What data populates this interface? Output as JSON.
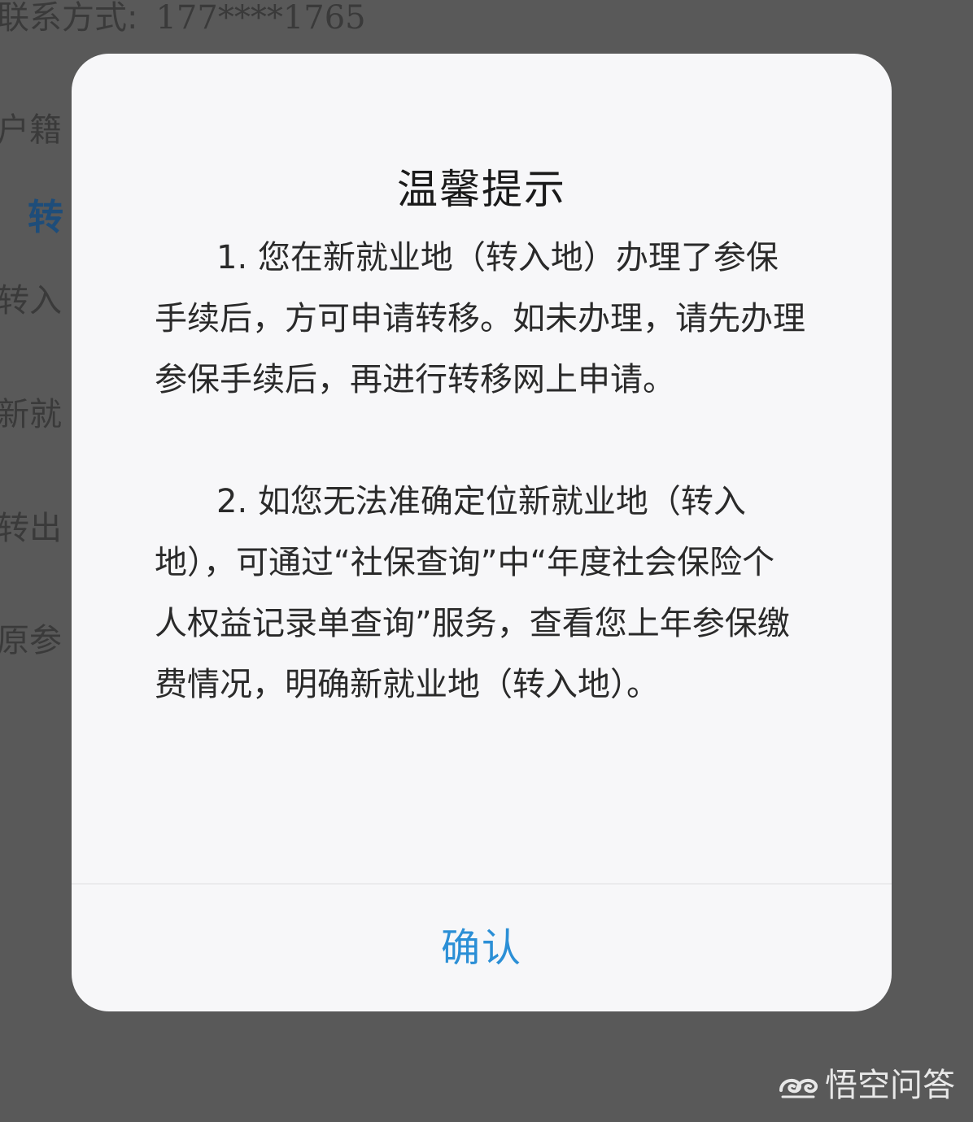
{
  "background": {
    "contact_label": "联系方式:",
    "contact_value": "177****1765",
    "huji_partial": "户籍",
    "section_partial": "转",
    "zhuanru_partial": "转入",
    "xinjiu_partial": "新就",
    "zhuanchu_partial": "转出",
    "yuancan_partial": "原参"
  },
  "dialog": {
    "title": "温馨提示",
    "paragraph_1": "1. 您在新就业地（转入地）办理了参保手续后，方可申请转移。如未办理，请先办理参保手续后，再进行转移网上申请。",
    "paragraph_2": "2. 如您无法准确定位新就业地（转入地），可通过“社保查询”中“年度社会保险个人权益记录单查询”服务，查看您上年参保缴费情况，明确新就业地（转入地）。",
    "confirm_label": "确认"
  },
  "watermark": {
    "text": "悟空问答",
    "icon": "wukong-logo-icon"
  },
  "colors": {
    "overlay": "#545454",
    "dialog_bg": "#f7f7f9",
    "confirm_accent": "#2b8fd6",
    "section_title": "#1e4d7a"
  }
}
